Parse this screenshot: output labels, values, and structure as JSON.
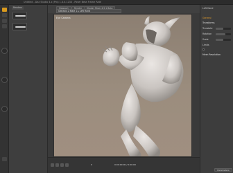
{
  "window": {
    "title": "Untitled - Daz Studio 4.x (Pro) 1.4.0.1234 - Poser Beta Frame Rate"
  },
  "left_tools": {
    "active": "posing-tool"
  },
  "left_panel": {
    "tab": "Renders"
  },
  "viewport": {
    "tabs": [
      "Viewport",
      "Render",
      "Shader Mixer 4.5.1 Beta"
    ],
    "subheader": "Genesis 2 Male 1 ▸ Left Hand",
    "camera_label": "Eye Camera"
  },
  "playback": {
    "frame": "0",
    "end_label": "0:00:00:00 / 0:00:00"
  },
  "right_panel": {
    "header": "Left Hand",
    "sections": [
      {
        "label": "General",
        "style": "orange"
      },
      {
        "label": "Transforms",
        "style": "sect"
      },
      {
        "label": "Translate",
        "style": "normal"
      },
      {
        "label": "Rotation",
        "style": "normal"
      },
      {
        "label": "Scale",
        "style": "normal"
      },
      {
        "label": "Limits",
        "style": "normal"
      },
      {
        "label": "Mesh Resolution",
        "style": "sect"
      }
    ],
    "button": "Parameters"
  },
  "colors": {
    "accent": "#d99a1e",
    "viewport_bg": "#9a8b7d",
    "skin": "#c9c4c0"
  }
}
